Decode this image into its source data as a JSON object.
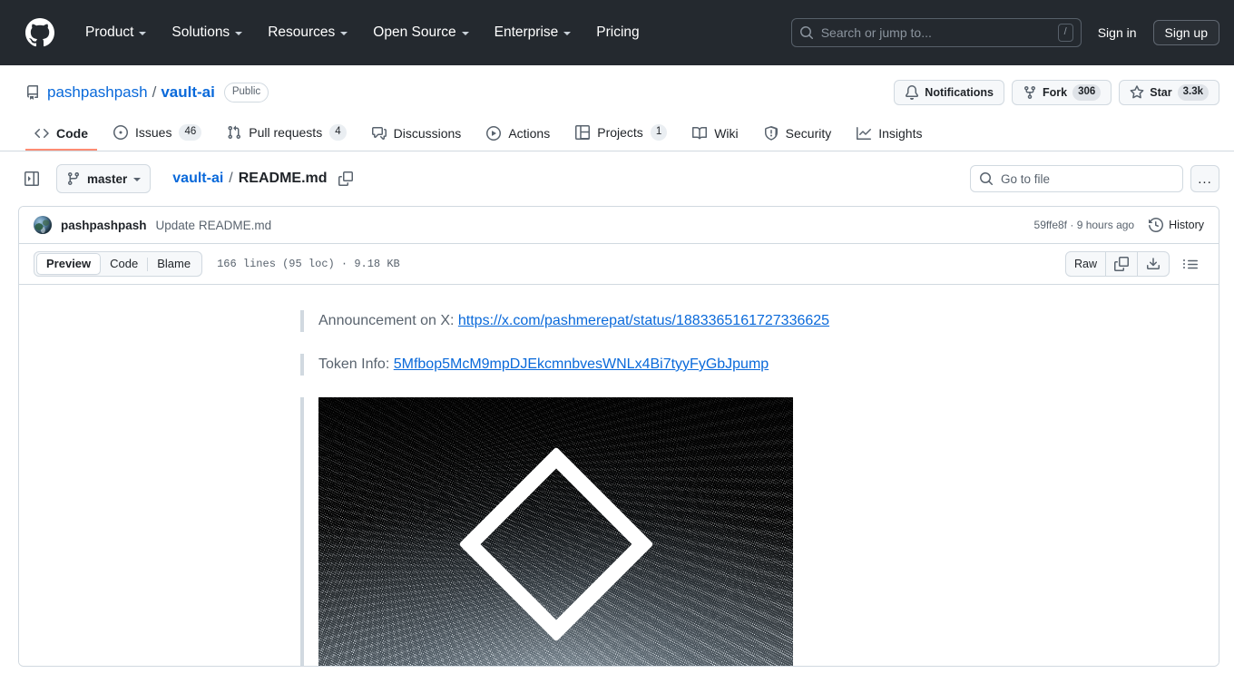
{
  "header": {
    "logo_icon": "github-mark-icon",
    "nav": [
      {
        "label": "Product",
        "has_caret": true
      },
      {
        "label": "Solutions",
        "has_caret": true
      },
      {
        "label": "Resources",
        "has_caret": true
      },
      {
        "label": "Open Source",
        "has_caret": true
      },
      {
        "label": "Enterprise",
        "has_caret": true
      },
      {
        "label": "Pricing",
        "has_caret": false
      }
    ],
    "search": {
      "placeholder": "Search or jump to...",
      "icon": "search-icon",
      "shortcut": "/"
    },
    "sign_in": "Sign in",
    "sign_up": "Sign up",
    "background_color": "#24292f"
  },
  "repo": {
    "icon": "repo-icon",
    "owner": "pashpashpash",
    "separator": "/",
    "name": "vault-ai",
    "visibility": "Public",
    "actions": [
      {
        "name": "notifications",
        "icon": "bell-icon",
        "label": "Notifications",
        "count": null
      },
      {
        "name": "fork",
        "icon": "fork-icon",
        "label": "Fork",
        "count": "306"
      },
      {
        "name": "star",
        "icon": "star-icon",
        "label": "Star",
        "count": "3.3k"
      }
    ],
    "tabs": [
      {
        "id": "code",
        "label": "Code",
        "icon": "code-icon",
        "count": null,
        "active": true
      },
      {
        "id": "issues",
        "label": "Issues",
        "icon": "issue-opened-icon",
        "count": "46",
        "active": false
      },
      {
        "id": "pull-requests",
        "label": "Pull requests",
        "icon": "git-pull-request-icon",
        "count": "4",
        "active": false
      },
      {
        "id": "discussions",
        "label": "Discussions",
        "icon": "comment-discussion-icon",
        "count": null,
        "active": false
      },
      {
        "id": "actions",
        "label": "Actions",
        "icon": "play-icon",
        "count": null,
        "active": false
      },
      {
        "id": "projects",
        "label": "Projects",
        "icon": "table-icon",
        "count": "1",
        "active": false
      },
      {
        "id": "wiki",
        "label": "Wiki",
        "icon": "book-icon",
        "count": null,
        "active": false
      },
      {
        "id": "security",
        "label": "Security",
        "icon": "shield-icon",
        "count": null,
        "active": false
      },
      {
        "id": "insights",
        "label": "Insights",
        "icon": "graph-icon",
        "count": null,
        "active": false
      }
    ]
  },
  "file_nav": {
    "sidebar_toggle_icon": "sidebar-expand-icon",
    "branch": "master",
    "branch_icon": "git-branch-icon",
    "breadcrumb_repo": "vault-ai",
    "breadcrumb_separator": "/",
    "breadcrumb_file": "README.md",
    "copy_path_icon": "copy-icon",
    "go_to_file_placeholder": "Go to file",
    "go_to_file_icon": "search-icon",
    "more_options": "..."
  },
  "commit": {
    "avatar": "user-avatar",
    "author": "pashpashpash",
    "message": "Update README.md",
    "sha": "59ffe8f",
    "meta_separator": "·",
    "relative_time": "9 hours ago",
    "history_label": "History",
    "history_icon": "history-icon"
  },
  "file_toolbar": {
    "views": [
      {
        "id": "preview",
        "label": "Preview",
        "active": true
      },
      {
        "id": "code",
        "label": "Code",
        "active": false
      },
      {
        "id": "blame",
        "label": "Blame",
        "active": false
      }
    ],
    "file_meta": "166 lines (95 loc) · 9.18 KB",
    "raw_label": "Raw",
    "copy_icon": "copy-raw-icon",
    "download_icon": "download-icon",
    "outline_icon": "outline-list-icon"
  },
  "readme": {
    "blockquotes": [
      {
        "prefix": "Announcement on X: ",
        "link_text": "https://x.com/pashmerepat/status/1883365161727336625"
      },
      {
        "prefix": "Token Info: ",
        "link_text": "5Mfbop5McM9mpDJEkcmnbvesWNLx4Bi7tyyFyGbJpump"
      }
    ],
    "image_alt": "vault-ai banner logo: white diamond outline on grainy dark noise background"
  },
  "colors": {
    "header_bg": "#24292f",
    "link": "#0969da",
    "muted": "#59636e",
    "border": "#d1d9e0",
    "active_tab_underline": "#fd8c73",
    "surface": "#f6f8fa"
  }
}
